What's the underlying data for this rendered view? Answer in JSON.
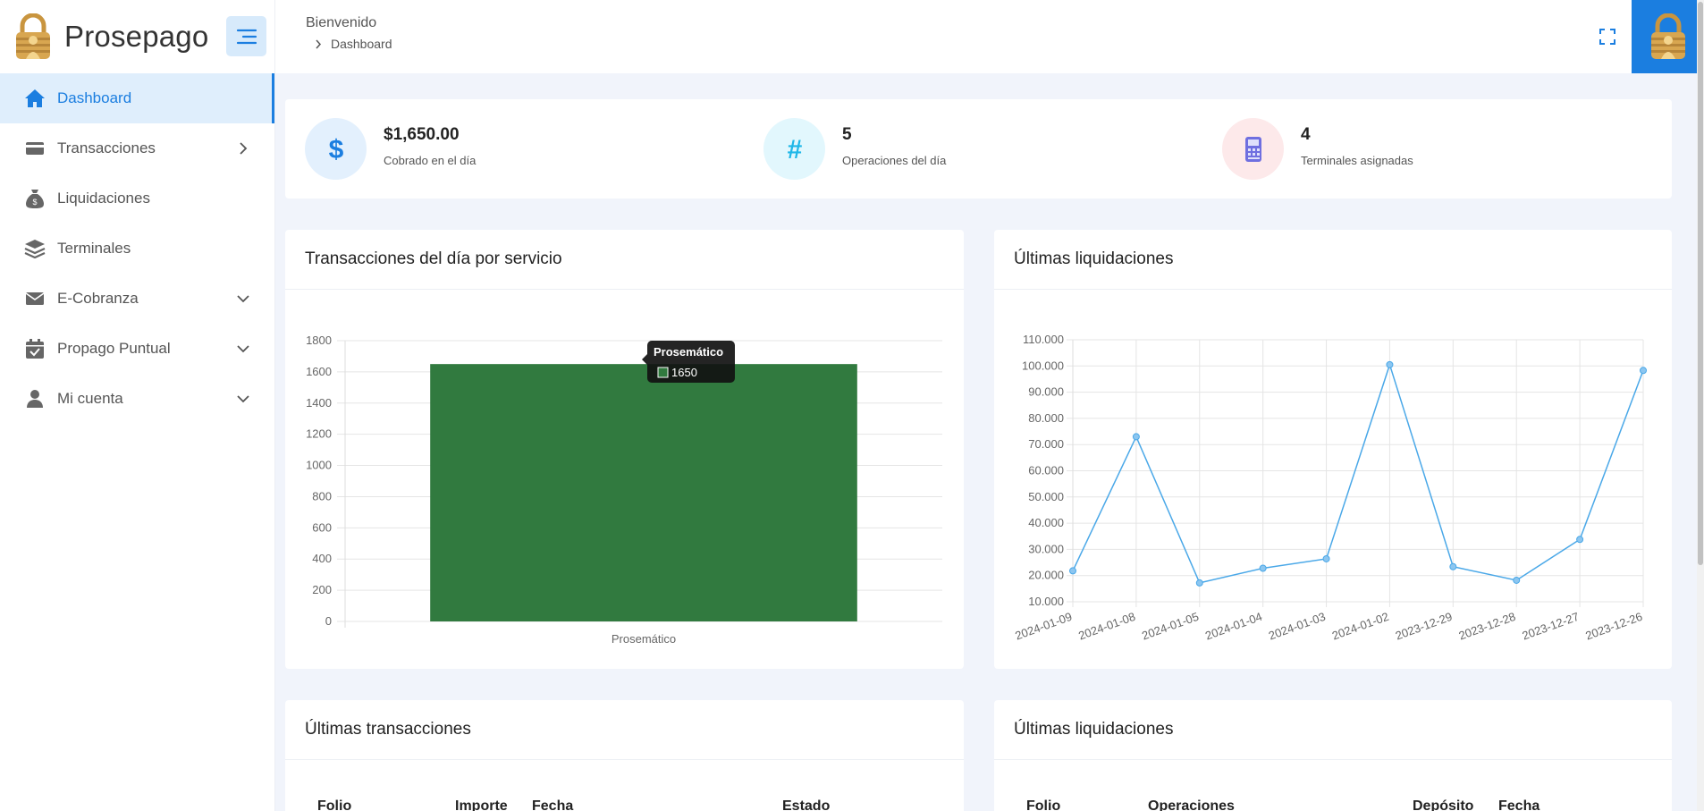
{
  "app": {
    "name": "Prosepago",
    "brand_color": "#1b7ee0"
  },
  "sidebar": {
    "items": [
      {
        "label": "Dashboard",
        "icon": "home-icon",
        "active": true
      },
      {
        "label": "Transacciones",
        "icon": "credit-card-icon",
        "chevron": "right"
      },
      {
        "label": "Liquidaciones",
        "icon": "money-bag-icon"
      },
      {
        "label": "Terminales",
        "icon": "layers-icon"
      },
      {
        "label": "E-Cobranza",
        "icon": "envelope-icon",
        "chevron": "down"
      },
      {
        "label": "Propago Puntual",
        "icon": "calendar-check-icon",
        "chevron": "down"
      },
      {
        "label": "Mi cuenta",
        "icon": "user-icon",
        "chevron": "down"
      }
    ]
  },
  "header": {
    "welcome": "Bienvenido",
    "breadcrumb": "Dashboard"
  },
  "stats": [
    {
      "value": "$1,650.00",
      "label": "Cobrado en el día",
      "icon": "dollar-icon",
      "color": "#1b7ee0",
      "bg": "#e3f0fd"
    },
    {
      "value": "5",
      "label": "Operaciones del día",
      "icon": "hash-icon",
      "color": "#1fb7e8",
      "bg": "#e2f7fd"
    },
    {
      "value": "4",
      "label": "Terminales asignadas",
      "icon": "pos-terminal-icon",
      "color": "#5a67d8",
      "bg": "#fde9ea"
    }
  ],
  "cards": {
    "bar_title": "Transacciones del día por servicio",
    "line_title": "Últimas liquidaciones",
    "transactions_title": "Últimas transacciones",
    "settlements_title": "Últimas liquidaciones"
  },
  "tables": {
    "transactions_headers": [
      "Folio",
      "Importe",
      "Fecha",
      "Estado"
    ],
    "settlements_headers": [
      "Folio",
      "Operaciones",
      "Depósito",
      "Fecha"
    ]
  },
  "tooltip": {
    "title": "Prosemático",
    "value": "1650"
  },
  "chart_data": [
    {
      "type": "bar",
      "categories": [
        "Prosemático"
      ],
      "series": [
        {
          "name": "Prosemático",
          "values": [
            1650
          ]
        }
      ],
      "ylim": [
        0,
        1800
      ],
      "yticks": [
        "0",
        "200",
        "400",
        "600",
        "800",
        "1000",
        "1200",
        "1400",
        "1600",
        "1800"
      ],
      "color": "#317a3f",
      "grid": true
    },
    {
      "type": "line",
      "x": [
        "2024-01-09",
        "2024-01-08",
        "2024-01-05",
        "2024-01-04",
        "2024-01-03",
        "2024-01-02",
        "2023-12-29",
        "2023-12-28",
        "2023-12-27",
        "2023-12-26"
      ],
      "values": [
        21800,
        73000,
        17200,
        22800,
        26400,
        100500,
        23400,
        18200,
        33800,
        98300
      ],
      "ylim": [
        10000,
        110000
      ],
      "yticks": [
        "10.000",
        "20.000",
        "30.000",
        "40.000",
        "50.000",
        "60.000",
        "70.000",
        "80.000",
        "90.000",
        "100.000",
        "110.000"
      ],
      "color": "#4aa8e8",
      "grid": true
    }
  ]
}
